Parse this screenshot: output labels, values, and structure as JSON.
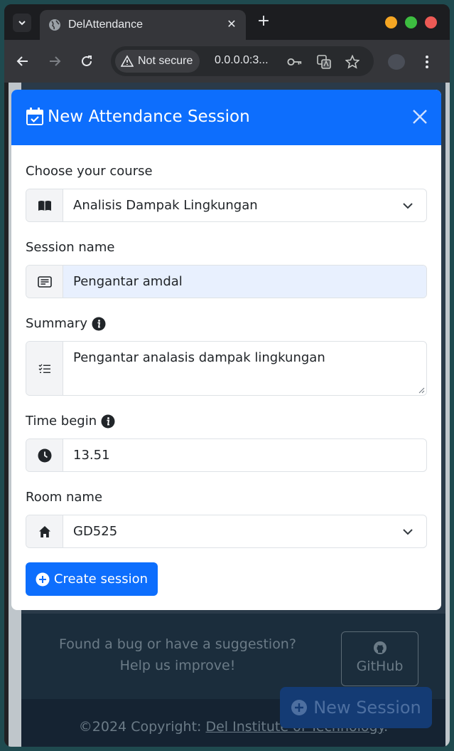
{
  "browser": {
    "tab_title": "DelAttendance",
    "security_chip": "Not secure",
    "url": "0.0.0.0:3..."
  },
  "page": {
    "footer_text": "Found a bug or have a suggestion? Help us improve!",
    "github_label": "GitHub",
    "copyright_prefix": "©2024 Copyright: ",
    "copyright_link": "Del Institute of Technology",
    "fab_label": "New Session"
  },
  "modal": {
    "title": "New Attendance Session",
    "course": {
      "label": "Choose your course",
      "value": "Analisis Dampak Lingkungan"
    },
    "session": {
      "label": "Session name",
      "value": "Pengantar amdal"
    },
    "summary": {
      "label": "Summary",
      "value": "Pengantar analasis dampak lingkungan"
    },
    "time": {
      "label": "Time begin",
      "value": "13.51"
    },
    "room": {
      "label": "Room name",
      "value": "GD525"
    },
    "submit_label": "Create session"
  },
  "colors": {
    "primary": "#0d6efd",
    "autofill": "#e8f0fe"
  }
}
